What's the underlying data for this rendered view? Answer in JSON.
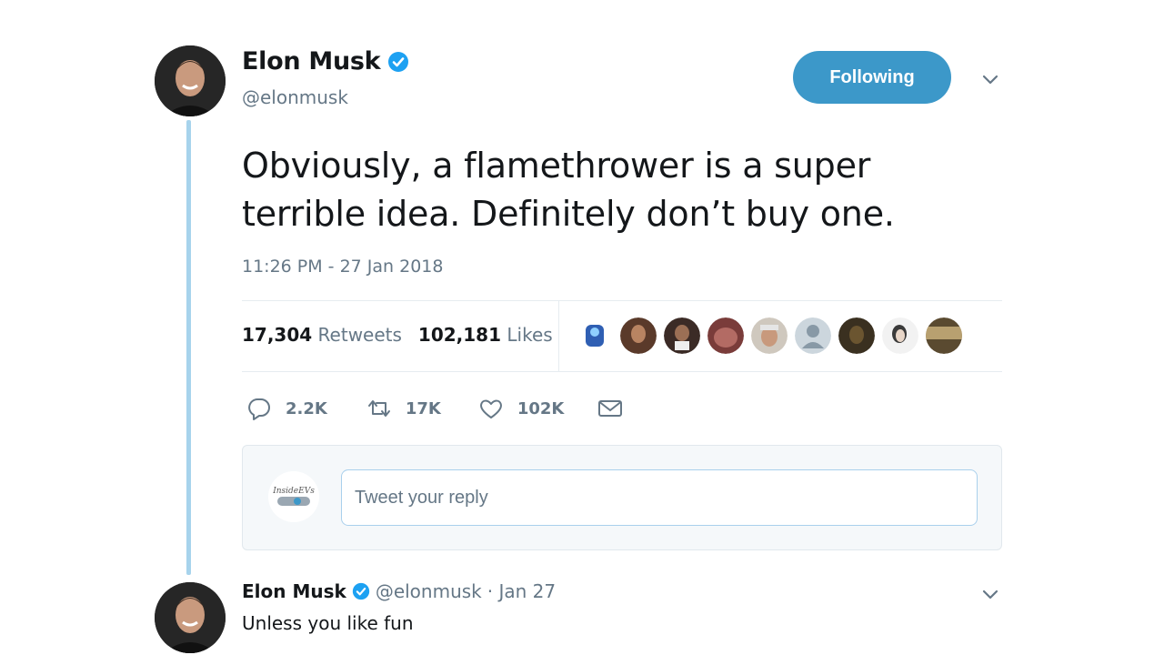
{
  "tweet": {
    "author_name": "Elon Musk",
    "author_handle": "@elonmusk",
    "follow_button": "Following",
    "text": "Obviously, a flamethrower is a super terrible idea. Definitely don’t buy one.",
    "timestamp": "11:26 PM - 27 Jan 2018",
    "retweets_count": "17,304",
    "retweets_label": "Retweets",
    "likes_count": "102,181",
    "likes_label": "Likes",
    "likers_count_shown": 9
  },
  "actions": {
    "reply_count": "2.2K",
    "retweet_count": "17K",
    "like_count": "102K"
  },
  "compose": {
    "placeholder": "Tweet your reply",
    "avatar_text": "InsideEVs"
  },
  "reply": {
    "author_name": "Elon Musk",
    "author_handle": "@elonmusk",
    "date": "· Jan 27",
    "text": "Unless you like fun"
  },
  "colors": {
    "accent": "#3c98c9",
    "thread_line": "#a7d3ec",
    "muted_text": "#657786",
    "verified": "#1da1f2"
  },
  "icons": [
    "verified-badge-icon",
    "chevron-down-icon",
    "reply-icon",
    "retweet-icon",
    "like-icon",
    "direct-message-icon"
  ]
}
